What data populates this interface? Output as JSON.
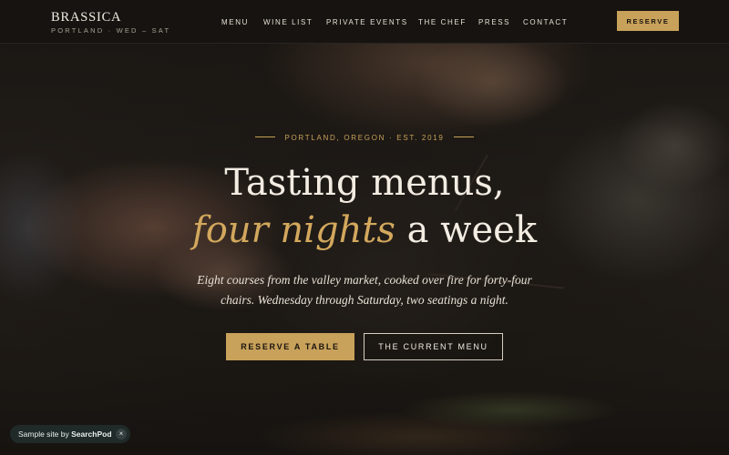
{
  "brand": {
    "name": "BRASSICA",
    "tagline": "PORTLAND · WED – SAT"
  },
  "nav": {
    "items": [
      "MENU",
      "WINE LIST",
      "PRIVATE EVENTS",
      "THE CHEF",
      "PRESS",
      "CONTACT"
    ],
    "reserve_label": "RESERVE"
  },
  "hero": {
    "eyebrow": "PORTLAND, OREGON · EST. 2019",
    "headline_line1": "Tasting menus,",
    "headline_accent": "four nights",
    "headline_line2_rest": " a week",
    "subtitle_line1": "Eight courses from the valley market, cooked over fire for forty-four",
    "subtitle_line2": "chairs. Wednesday through Saturday, two seatings a night.",
    "cta_primary": "RESERVE A TABLE",
    "cta_secondary": "THE CURRENT MENU"
  },
  "toast": {
    "prefix": "Sample site by ",
    "brand": "SearchPod",
    "close": "×"
  },
  "colors": {
    "accent": "#c8a15a",
    "background": "#14110f",
    "toast_bg": "#1f2a29"
  }
}
